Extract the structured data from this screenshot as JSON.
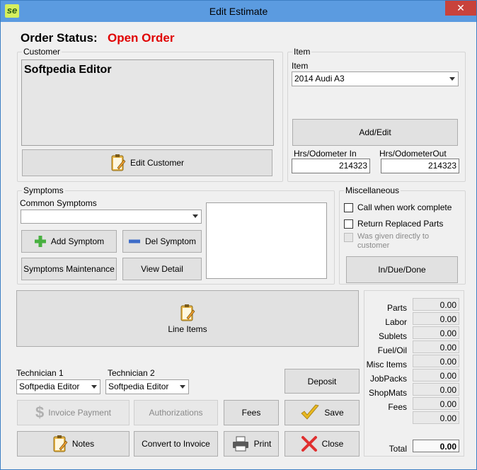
{
  "window": {
    "title": "Edit Estimate",
    "app_icon_text": "se",
    "close_glyph": "✕"
  },
  "order_status": {
    "label": "Order Status:",
    "value": "Open Order",
    "value_color": "#e00000"
  },
  "customer": {
    "group_label": "Customer",
    "name": "Softpedia Editor",
    "edit_button": "Edit Customer"
  },
  "item": {
    "group_label": "Item",
    "field_label": "Item",
    "selected": "2014 Audi A3",
    "add_edit_button": "Add/Edit",
    "odometer_in_label": "Hrs/Odometer In",
    "odometer_in": "214323",
    "odometer_out_label": "Hrs/OdometerOut",
    "odometer_out": "214323"
  },
  "symptoms": {
    "group_label": "Symptoms",
    "common_label": "Common Symptoms",
    "common_selected": "",
    "add_button": "Add Symptom",
    "del_button": "Del Symptom",
    "maintenance_button": "Symptoms Maintenance",
    "view_detail_button": "View Detail"
  },
  "misc": {
    "group_label": "Miscellaneous",
    "call_when_complete": "Call when work complete",
    "return_parts": "Return Replaced Parts",
    "given_directly": "Was given directly to customer",
    "in_due_done_button": "In/Due/Done"
  },
  "line_items_button": "Line Items",
  "technicians": {
    "tech1_label": "Technician 1",
    "tech1_value": "Softpedia Editor",
    "tech2_label": "Technician 2",
    "tech2_value": "Softpedia Editor"
  },
  "actions": {
    "deposit": "Deposit",
    "invoice_payment": "Invoice Payment",
    "authorizations": "Authorizations",
    "fees": "Fees",
    "save": "Save",
    "notes": "Notes",
    "convert_to_invoice": "Convert to Invoice",
    "print": "Print",
    "close": "Close"
  },
  "summary": {
    "rows": [
      {
        "label": "Parts",
        "value": "0.00"
      },
      {
        "label": "Labor",
        "value": "0.00"
      },
      {
        "label": "Sublets",
        "value": "0.00"
      },
      {
        "label": "Fuel/Oil",
        "value": "0.00"
      },
      {
        "label": "Misc Items",
        "value": "0.00"
      },
      {
        "label": "JobPacks",
        "value": "0.00"
      },
      {
        "label": "ShopMats",
        "value": "0.00"
      },
      {
        "label": "Fees",
        "value": "0.00"
      },
      {
        "label": "",
        "value": "0.00"
      }
    ],
    "total_label": "Total",
    "total_value": "0.00"
  },
  "colors": {
    "titlebar": "#5b9be0",
    "accent_red": "#e00000",
    "close_red": "#c8423b"
  }
}
